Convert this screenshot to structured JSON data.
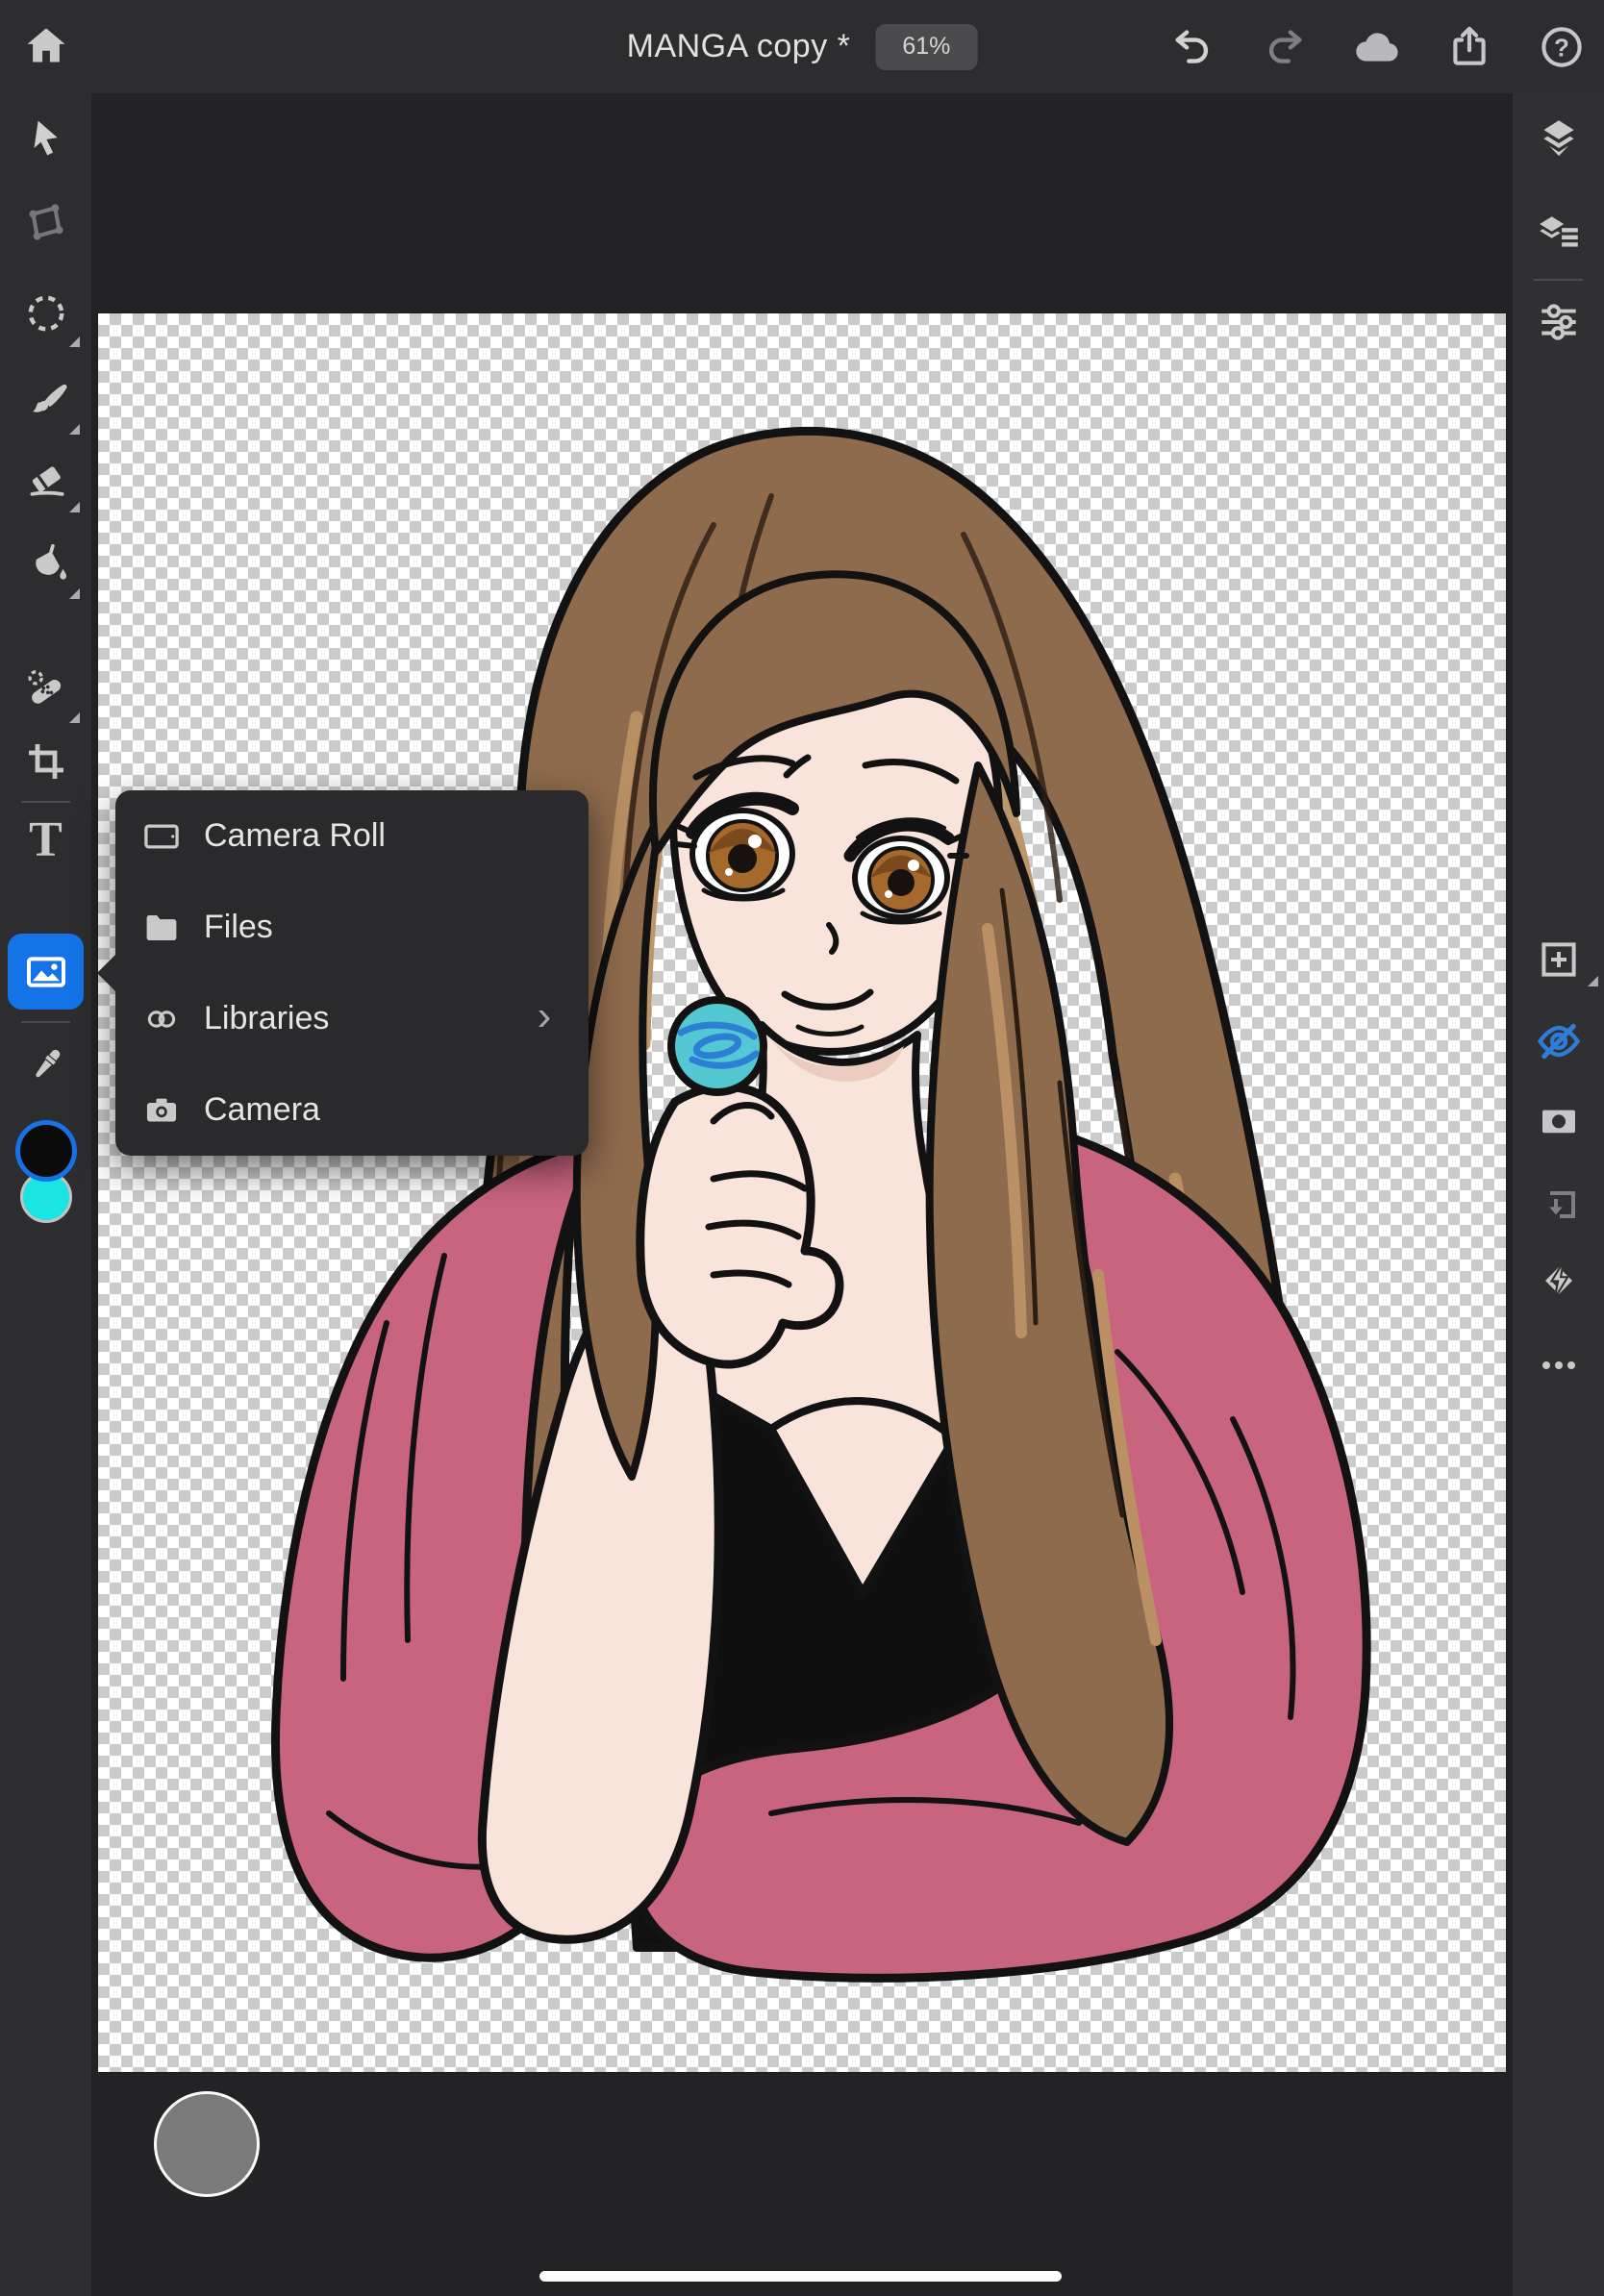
{
  "top_bar": {
    "title": "MANGA copy *",
    "zoom_badge": "61%",
    "help_glyph": "?",
    "icons": [
      "home-icon",
      "undo-icon",
      "redo-icon",
      "cloud-sync-icon",
      "share-icon",
      "help-icon"
    ]
  },
  "left_toolbar": {
    "type_glyph": "T",
    "tools": [
      {
        "name": "move-tool",
        "icon": "move-cursor-icon"
      },
      {
        "name": "transform-tool",
        "icon": "transform-quad-icon",
        "dimmed": true
      },
      {
        "name": "selection-tool",
        "icon": "marquee-ellipse-icon",
        "has_options": true
      },
      {
        "name": "brush-tool",
        "icon": "brush-icon",
        "has_options": true
      },
      {
        "name": "eraser-tool",
        "icon": "eraser-icon",
        "has_options": true
      },
      {
        "name": "fill-tool",
        "icon": "paint-bucket-icon",
        "has_options": true
      },
      {
        "name": "heal-tool",
        "icon": "healing-bandage-icon",
        "has_options": true
      },
      {
        "name": "crop-tool",
        "icon": "crop-icon"
      },
      {
        "name": "type-tool",
        "icon": "type-icon"
      },
      {
        "name": "place-image-tool",
        "icon": "image-icon",
        "active": true
      },
      {
        "name": "eyedropper-tool",
        "icon": "eyedropper-icon"
      }
    ],
    "swatches": {
      "primary": "#0B0B0B",
      "primary_ring": "#1473E6",
      "secondary": "#1BE5E2"
    }
  },
  "place_menu": {
    "items": [
      {
        "label": "Camera Roll",
        "icon": "tablet-icon"
      },
      {
        "label": "Files",
        "icon": "folder-icon"
      },
      {
        "label": "Libraries",
        "icon": "creative-cloud-icon",
        "has_submenu": true
      },
      {
        "label": "Camera",
        "icon": "camera-icon"
      }
    ],
    "submenu_chevron": "›"
  },
  "right_toolbar": {
    "top_icons": [
      "layers-icon",
      "layer-properties-icon",
      "adjustments-icon"
    ],
    "bottom_icons": [
      "add-layer-icon",
      "layer-hidden-icon",
      "mask-icon",
      "clip-layer-icon",
      "layer-effects-icon",
      "more-icon"
    ],
    "hidden_layer_accent": "#1473E6"
  },
  "canvas": {
    "artwork_subject": "manga girl, long brown hair, pink shawl, black camisole, holding teal lollipop",
    "checker_light": "#FFFFFF",
    "checker_dark": "#CBCBCB"
  },
  "bottom_bar": {
    "control": "touch-shortcut-circle"
  },
  "colors": {
    "accent": "#1473E6",
    "bar_bg": "#2D2D2F",
    "canvas_bg": "#232325",
    "popup_bg": "#2A2A2C",
    "badge_bg": "#4B4B4D",
    "skin": "#F8E4DB",
    "hair": "#8F6B4D",
    "hair_highlight": "#BA9064",
    "shawl_pink": "#C9647F",
    "lollipop_teal": "#54C8D2",
    "lollipop_swirl": "#2D7FD6"
  }
}
